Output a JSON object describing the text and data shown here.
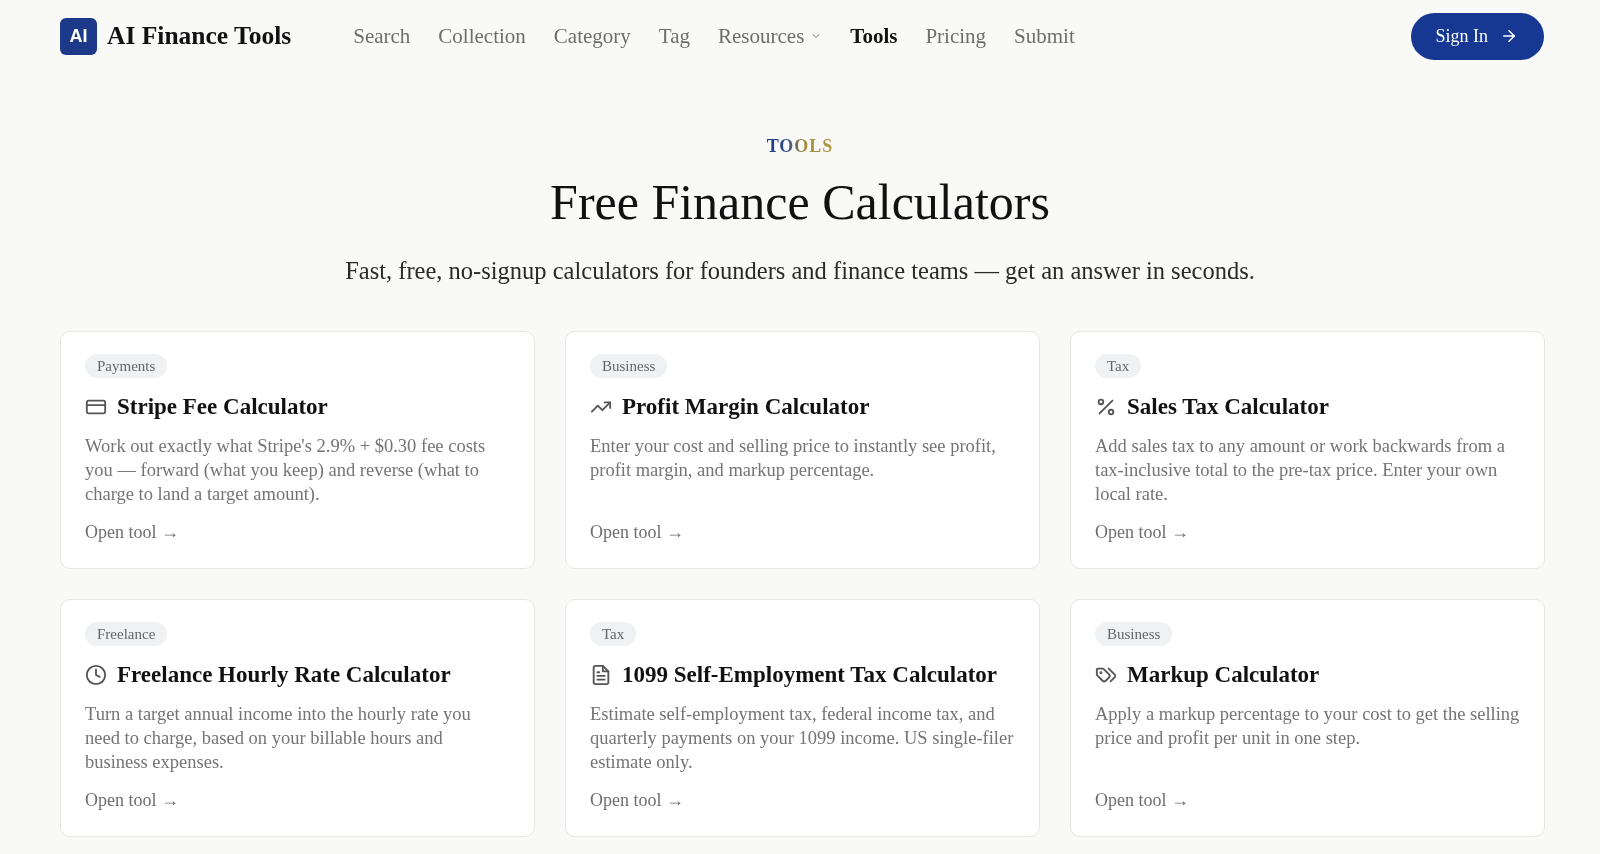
{
  "header": {
    "logo": {
      "mark": "AI",
      "name": "AI Finance Tools"
    },
    "nav": [
      {
        "label": "Search",
        "kind": "link",
        "selected": false
      },
      {
        "label": "Collection",
        "kind": "link",
        "selected": false
      },
      {
        "label": "Category",
        "kind": "link",
        "selected": false
      },
      {
        "label": "Tag",
        "kind": "link",
        "selected": false
      },
      {
        "label": "Resources",
        "kind": "dropdown",
        "selected": false
      },
      {
        "label": "Tools",
        "kind": "link",
        "selected": true
      },
      {
        "label": "Pricing",
        "kind": "link",
        "selected": false
      },
      {
        "label": "Submit",
        "kind": "link",
        "selected": false
      }
    ],
    "sign_in": {
      "label": "Sign In"
    }
  },
  "hero": {
    "eyebrow": "TOOLS",
    "title": "Free Finance Calculators",
    "subtitle": "Fast, free, no-signup calculators for founders and finance teams — get an answer in seconds."
  },
  "tools": [
    {
      "tag": "Payments",
      "title": "Stripe Fee Calculator",
      "description": "Work out exactly what Stripe's 2.9% + $0.30 fee costs you — forward (what you keep) and reverse (what to charge to land a target amount).",
      "link": "Open tool →"
    },
    {
      "tag": "Business",
      "title": "Profit Margin Calculator",
      "description": "Enter your cost and selling price to instantly see profit, profit margin, and markup percentage.",
      "link": "Open tool →"
    },
    {
      "tag": "Tax",
      "title": "Sales Tax Calculator",
      "description": "Add sales tax to any amount or work backwards from a tax-inclusive total to the pre-tax price. Enter your own local rate.",
      "link": "Open tool →"
    },
    {
      "tag": "Freelance",
      "title": "Freelance Hourly Rate Calculator",
      "description": "Turn a target annual income into the hourly rate you need to charge, based on your billable hours and business expenses.",
      "link": "Open tool →"
    },
    {
      "tag": "Tax",
      "title": "1099 Self-Employment Tax Calculator",
      "description": "Estimate self-employment tax, federal income tax, and quarterly payments on your 1099 income. US single-filer estimate only.",
      "link": "Open tool →"
    },
    {
      "tag": "Business",
      "title": "Markup Calculator",
      "description": "Apply a markup percentage to your cost to get the selling price and profit per unit in one step.",
      "link": "Open tool →"
    }
  ]
}
